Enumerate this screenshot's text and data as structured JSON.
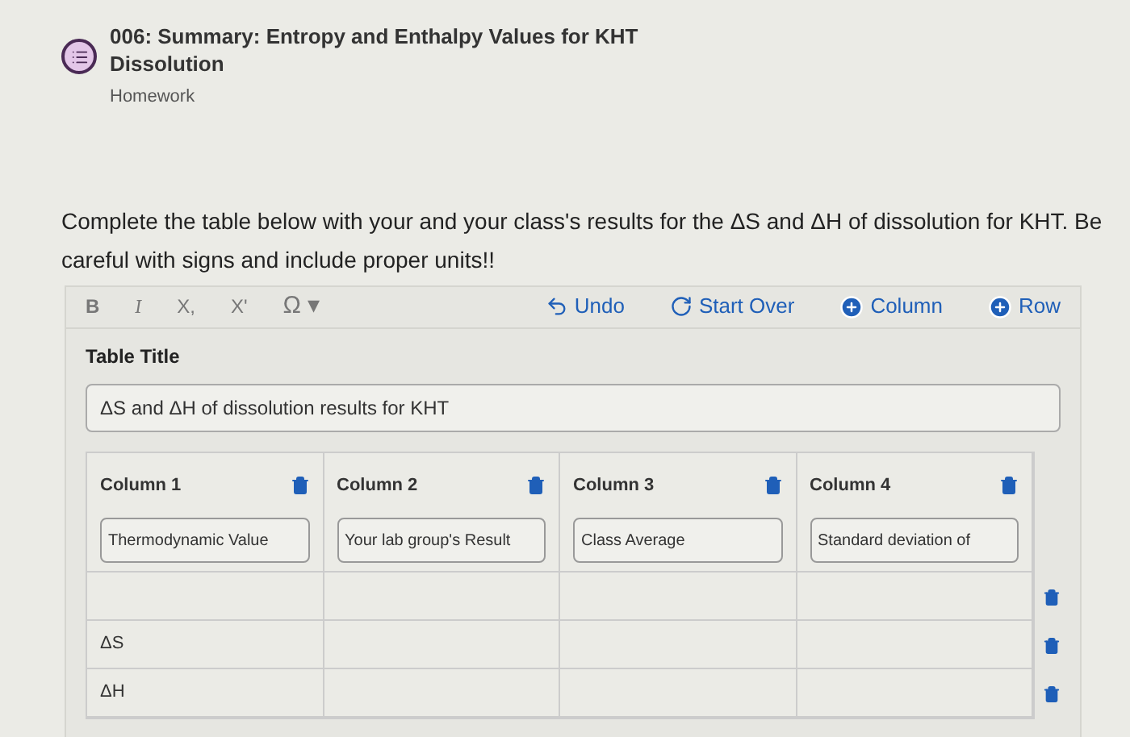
{
  "header": {
    "title": "006: Summary: Entropy and Enthalpy Values for KHT Dissolution",
    "subtitle": "Homework"
  },
  "question": [
    "Complete the table below with your and your class's results for the ΔS and ΔH of dissolution for KHT. Be",
    "careful with signs and include proper units!!"
  ],
  "toolbar": {
    "format_buttons": [
      {
        "label": "B",
        "kind": "bold"
      },
      {
        "label": "I",
        "kind": "italic"
      },
      {
        "label": "X,",
        "kind": "sub"
      },
      {
        "label": "X'",
        "kind": "sup"
      },
      {
        "label": "Ω ▾",
        "kind": "symbol"
      }
    ],
    "actions": [
      {
        "label": "Undo",
        "kind": "undo"
      },
      {
        "label": "Start Over",
        "kind": "reset"
      },
      {
        "label": "Column",
        "kind": "add"
      },
      {
        "label": "Row",
        "kind": "add"
      }
    ]
  },
  "table_title": {
    "label": "Table Title",
    "value": "ΔS and ΔH of dissolution results for KHT"
  },
  "table": {
    "columns": [
      {
        "heading": "Column 1",
        "value": "Thermodynamic Value"
      },
      {
        "heading": "Column 2",
        "value": "Your lab group's Result"
      },
      {
        "heading": "Column 3",
        "value": "Class Average"
      },
      {
        "heading": "Column 4",
        "value": "Standard deviation of"
      }
    ],
    "rows": [
      [
        "",
        "",
        "",
        ""
      ],
      [
        "ΔS",
        "",
        "",
        ""
      ],
      [
        "ΔH",
        "",
        "",
        ""
      ]
    ]
  }
}
